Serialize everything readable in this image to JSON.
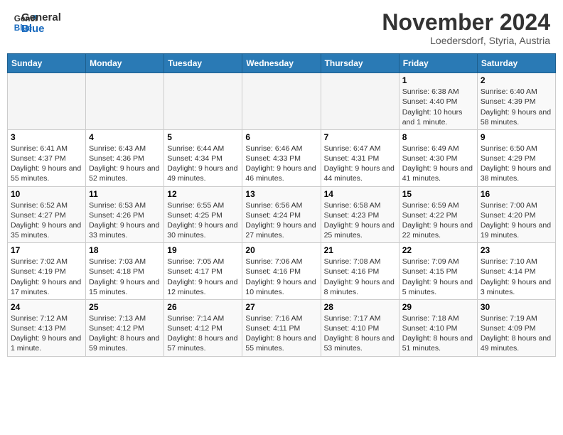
{
  "header": {
    "logo_line1": "General",
    "logo_line2": "Blue",
    "month": "November 2024",
    "location": "Loedersdorf, Styria, Austria"
  },
  "weekdays": [
    "Sunday",
    "Monday",
    "Tuesday",
    "Wednesday",
    "Thursday",
    "Friday",
    "Saturday"
  ],
  "weeks": [
    [
      {
        "day": "",
        "content": ""
      },
      {
        "day": "",
        "content": ""
      },
      {
        "day": "",
        "content": ""
      },
      {
        "day": "",
        "content": ""
      },
      {
        "day": "",
        "content": ""
      },
      {
        "day": "1",
        "content": "Sunrise: 6:38 AM\nSunset: 4:40 PM\nDaylight: 10 hours and 1 minute."
      },
      {
        "day": "2",
        "content": "Sunrise: 6:40 AM\nSunset: 4:39 PM\nDaylight: 9 hours and 58 minutes."
      }
    ],
    [
      {
        "day": "3",
        "content": "Sunrise: 6:41 AM\nSunset: 4:37 PM\nDaylight: 9 hours and 55 minutes."
      },
      {
        "day": "4",
        "content": "Sunrise: 6:43 AM\nSunset: 4:36 PM\nDaylight: 9 hours and 52 minutes."
      },
      {
        "day": "5",
        "content": "Sunrise: 6:44 AM\nSunset: 4:34 PM\nDaylight: 9 hours and 49 minutes."
      },
      {
        "day": "6",
        "content": "Sunrise: 6:46 AM\nSunset: 4:33 PM\nDaylight: 9 hours and 46 minutes."
      },
      {
        "day": "7",
        "content": "Sunrise: 6:47 AM\nSunset: 4:31 PM\nDaylight: 9 hours and 44 minutes."
      },
      {
        "day": "8",
        "content": "Sunrise: 6:49 AM\nSunset: 4:30 PM\nDaylight: 9 hours and 41 minutes."
      },
      {
        "day": "9",
        "content": "Sunrise: 6:50 AM\nSunset: 4:29 PM\nDaylight: 9 hours and 38 minutes."
      }
    ],
    [
      {
        "day": "10",
        "content": "Sunrise: 6:52 AM\nSunset: 4:27 PM\nDaylight: 9 hours and 35 minutes."
      },
      {
        "day": "11",
        "content": "Sunrise: 6:53 AM\nSunset: 4:26 PM\nDaylight: 9 hours and 33 minutes."
      },
      {
        "day": "12",
        "content": "Sunrise: 6:55 AM\nSunset: 4:25 PM\nDaylight: 9 hours and 30 minutes."
      },
      {
        "day": "13",
        "content": "Sunrise: 6:56 AM\nSunset: 4:24 PM\nDaylight: 9 hours and 27 minutes."
      },
      {
        "day": "14",
        "content": "Sunrise: 6:58 AM\nSunset: 4:23 PM\nDaylight: 9 hours and 25 minutes."
      },
      {
        "day": "15",
        "content": "Sunrise: 6:59 AM\nSunset: 4:22 PM\nDaylight: 9 hours and 22 minutes."
      },
      {
        "day": "16",
        "content": "Sunrise: 7:00 AM\nSunset: 4:20 PM\nDaylight: 9 hours and 19 minutes."
      }
    ],
    [
      {
        "day": "17",
        "content": "Sunrise: 7:02 AM\nSunset: 4:19 PM\nDaylight: 9 hours and 17 minutes."
      },
      {
        "day": "18",
        "content": "Sunrise: 7:03 AM\nSunset: 4:18 PM\nDaylight: 9 hours and 15 minutes."
      },
      {
        "day": "19",
        "content": "Sunrise: 7:05 AM\nSunset: 4:17 PM\nDaylight: 9 hours and 12 minutes."
      },
      {
        "day": "20",
        "content": "Sunrise: 7:06 AM\nSunset: 4:16 PM\nDaylight: 9 hours and 10 minutes."
      },
      {
        "day": "21",
        "content": "Sunrise: 7:08 AM\nSunset: 4:16 PM\nDaylight: 9 hours and 8 minutes."
      },
      {
        "day": "22",
        "content": "Sunrise: 7:09 AM\nSunset: 4:15 PM\nDaylight: 9 hours and 5 minutes."
      },
      {
        "day": "23",
        "content": "Sunrise: 7:10 AM\nSunset: 4:14 PM\nDaylight: 9 hours and 3 minutes."
      }
    ],
    [
      {
        "day": "24",
        "content": "Sunrise: 7:12 AM\nSunset: 4:13 PM\nDaylight: 9 hours and 1 minute."
      },
      {
        "day": "25",
        "content": "Sunrise: 7:13 AM\nSunset: 4:12 PM\nDaylight: 8 hours and 59 minutes."
      },
      {
        "day": "26",
        "content": "Sunrise: 7:14 AM\nSunset: 4:12 PM\nDaylight: 8 hours and 57 minutes."
      },
      {
        "day": "27",
        "content": "Sunrise: 7:16 AM\nSunset: 4:11 PM\nDaylight: 8 hours and 55 minutes."
      },
      {
        "day": "28",
        "content": "Sunrise: 7:17 AM\nSunset: 4:10 PM\nDaylight: 8 hours and 53 minutes."
      },
      {
        "day": "29",
        "content": "Sunrise: 7:18 AM\nSunset: 4:10 PM\nDaylight: 8 hours and 51 minutes."
      },
      {
        "day": "30",
        "content": "Sunrise: 7:19 AM\nSunset: 4:09 PM\nDaylight: 8 hours and 49 minutes."
      }
    ]
  ]
}
